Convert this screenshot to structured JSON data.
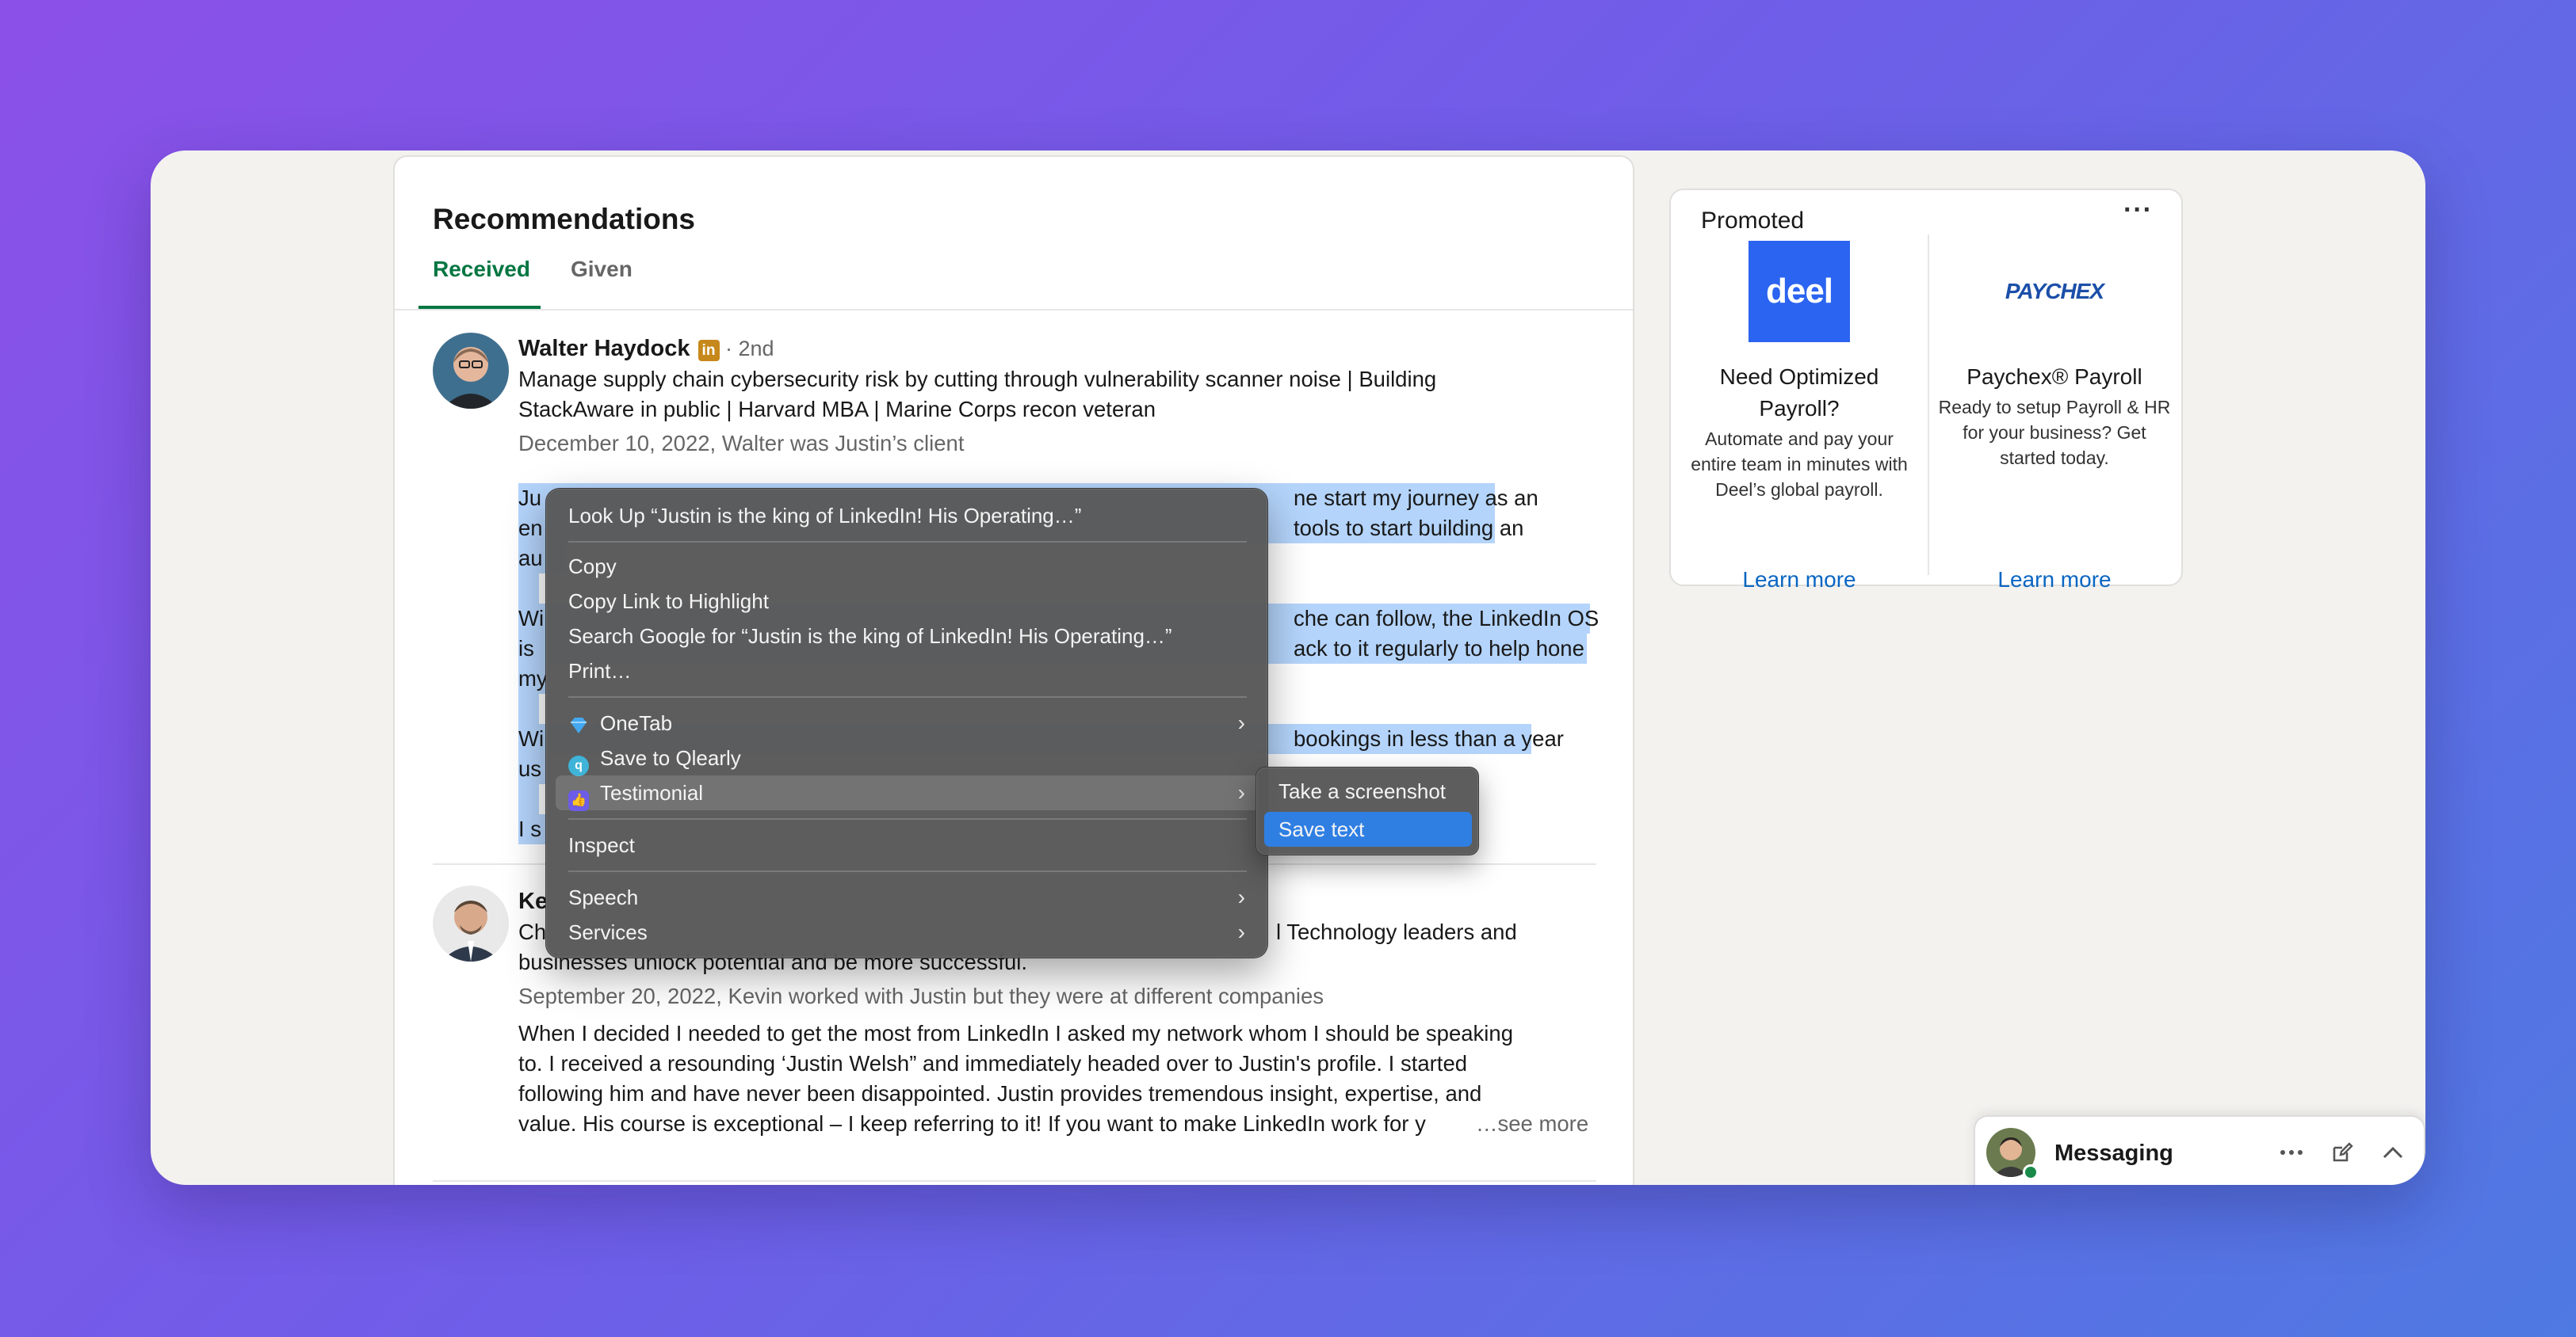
{
  "recommendations": {
    "title": "Recommendations",
    "tabs": [
      "Received",
      "Given"
    ],
    "active_tab": "Received"
  },
  "rec1": {
    "name": "Walter Haydock",
    "badge": "in",
    "degree": " · 2nd",
    "headline_line1": "Manage supply chain cybersecurity risk by cutting through vulnerability scanner noise | Building",
    "headline_line2": "StackAware in public | Harvard MBA | Marine Corps recon veteran",
    "meta": "December 10, 2022, Walter was Justin’s client",
    "body_left": [
      "Ju",
      "en",
      "au",
      "Wi",
      "is",
      "my",
      "Wi",
      "us",
      "I s"
    ],
    "body_right": [
      "ne start my journey as an",
      "tools to start building an",
      "che can follow, the LinkedIn OS",
      "ack to it regularly to help hone",
      "bookings in less than a year"
    ]
  },
  "rec2": {
    "name_partial": "Ke",
    "headline_partial_left": "Ch",
    "headline_partial_right": "l Technology leaders and",
    "headline_line2": "businesses unlock potential and be more successful.",
    "meta": "September 20, 2022, Kevin worked with Justin but they were at different companies",
    "body": [
      "When I decided I needed to get the most from LinkedIn I asked my network whom I should be speaking",
      "to. I received a resounding ‘Justin Welsh” and immediately headed over to Justin's profile. I started",
      "following him and have never been disappointed. Justin provides tremendous insight, expertise, and",
      "value. His course is exceptional – I keep referring to it! If you want to make LinkedIn work for y"
    ],
    "see_more": "…see more"
  },
  "promoted": {
    "label": "Promoted",
    "more_icon": "ellipsis-icon",
    "ads": [
      {
        "logo_text": "deel",
        "title": "Need Optimized Payroll?",
        "desc": "Automate and pay your entire team in minutes with Deel’s global payroll.",
        "cta": "Learn more"
      },
      {
        "logo_text": "PAYCHEX",
        "title": "Paychex® Payroll",
        "desc": "Ready to setup Payroll & HR for your business? Get started today.",
        "cta": "Learn more"
      }
    ]
  },
  "messaging": {
    "title": "Messaging"
  },
  "context_menu": {
    "lookup": "Look Up “Justin is the king of LinkedIn! His Operating…”",
    "copy": "Copy",
    "copy_link": "Copy Link to Highlight",
    "search": "Search Google for “Justin is the king of LinkedIn! His Operating…”",
    "print": "Print…",
    "onetab": "OneTab",
    "qlearly": "Save to Qlearly",
    "testimonial": "Testimonial",
    "inspect": "Inspect",
    "speech": "Speech",
    "services": "Services"
  },
  "submenu": {
    "screenshot": "Take a screenshot",
    "save_text": "Save text"
  },
  "colors": {
    "accent_green": "#057642",
    "link_blue": "#0a66c2",
    "selection": "#b4d4fb",
    "menu_highlight": "#2f7fe3",
    "deel_blue": "#2b64f0",
    "paychex_blue": "#1b4fa8"
  }
}
